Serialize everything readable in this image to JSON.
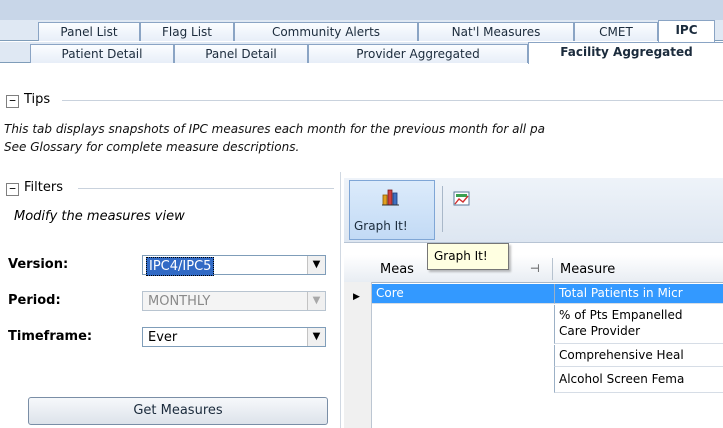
{
  "tabs_row1": [
    "Panel List",
    "Flag List",
    "Community Alerts",
    "Nat'l Measures",
    "CMET",
    "IPC"
  ],
  "tabs_row2": [
    "Patient Detail",
    "Panel Detail",
    "Provider Aggregated",
    "Facility Aggregated"
  ],
  "tips": {
    "toggle": "−",
    "title": "Tips",
    "line1": "This tab displays snapshots of IPC measures each month for the previous month for all pa",
    "line2": "See Glossary for complete measure descriptions."
  },
  "filters": {
    "toggle": "−",
    "title": "Filters",
    "subtitle": "Modify the measures view",
    "version_label": "Version:",
    "version_value": "IPC4/IPC5",
    "period_label": "Period:",
    "period_value": "MONTHLY",
    "timeframe_label": "Timeframe:",
    "timeframe_value": "Ever",
    "get_button": "Get Measures"
  },
  "toolbar": {
    "graph_label": "Graph It!",
    "tooltip": "Graph It!"
  },
  "grid": {
    "col1_header": "Meas",
    "col2_header": "Measure",
    "rows": [
      {
        "group": "Core",
        "measure": "Total Patients in Micr"
      },
      {
        "group": "",
        "measure": "% of Pts Empanelled"
      },
      {
        "group": "",
        "measure": "Care Provider"
      },
      {
        "group": "",
        "measure": "Comprehensive Heal"
      },
      {
        "group": "",
        "measure": "Alcohol Screen Fema"
      }
    ]
  },
  "colors": {
    "selection": "#3399ff",
    "tab_bg": "#dfe8f3",
    "tooltip_bg": "#ffffe1"
  }
}
